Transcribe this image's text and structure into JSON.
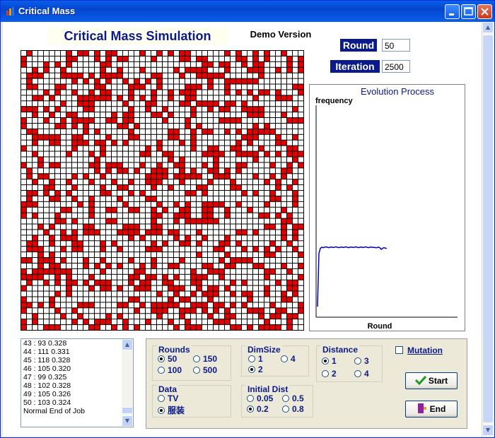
{
  "window": {
    "title": "Critical Mass"
  },
  "header": {
    "app_title": "Critical Mass Simulation",
    "demo_label": "Demo Version"
  },
  "params": {
    "round_label": "Round",
    "round_value": "50",
    "iteration_label": "Iteration",
    "iteration_value": "2500"
  },
  "chart": {
    "title": "Evolution Process",
    "ylabel": "frequency",
    "xlabel": "Round"
  },
  "chart_data": {
    "type": "line",
    "title": "Evolution Process",
    "xlabel": "Round",
    "ylabel": "frequency",
    "x": [
      1,
      2,
      3,
      4,
      5,
      6,
      7,
      8,
      9,
      10,
      11,
      12,
      13,
      14,
      15,
      16,
      17,
      18,
      19,
      20,
      21,
      22,
      23,
      24,
      25,
      26,
      27,
      28,
      29,
      30,
      31,
      32,
      33,
      34,
      35,
      36,
      37,
      38,
      39,
      40,
      41,
      42,
      43,
      44,
      45,
      46,
      47,
      48,
      49,
      50
    ],
    "values": [
      0.05,
      0.3,
      0.325,
      0.33,
      0.328,
      0.33,
      0.332,
      0.33,
      0.328,
      0.33,
      0.331,
      0.329,
      0.33,
      0.332,
      0.33,
      0.328,
      0.33,
      0.331,
      0.329,
      0.33,
      0.332,
      0.33,
      0.328,
      0.33,
      0.331,
      0.329,
      0.33,
      0.332,
      0.33,
      0.328,
      0.33,
      0.331,
      0.329,
      0.33,
      0.332,
      0.33,
      0.328,
      0.33,
      0.331,
      0.329,
      0.33,
      0.328,
      0.328,
      0.331,
      0.328,
      0.32,
      0.325,
      0.328,
      0.326,
      0.324
    ],
    "xlim": [
      0,
      100
    ],
    "ylim": [
      0,
      1
    ],
    "grid": false
  },
  "log": {
    "lines": [
      "43 : 93  0.328",
      "44 : 111  0.331",
      "45 : 118  0.328",
      "46 : 105  0.320",
      "47 : 99  0.325",
      "48 : 102  0.328",
      "49 : 105  0.326",
      "50 : 103  0.324",
      "Normal End of Job"
    ]
  },
  "controls": {
    "rounds": {
      "label": "Rounds",
      "options": [
        "50",
        "150",
        "100",
        "500"
      ],
      "selected": "50"
    },
    "dimsize": {
      "label": "DimSize",
      "options": [
        "1",
        "4",
        "2"
      ],
      "selected": "2"
    },
    "distance": {
      "label": "Distance",
      "options": [
        "1",
        "3",
        "2",
        "4"
      ],
      "selected": "1"
    },
    "data": {
      "label": "Data",
      "options": [
        "TV",
        "服装"
      ],
      "selected": "服装"
    },
    "initial_dist": {
      "label": "Initial Dist",
      "options": [
        "0.05",
        "0.5",
        "0.2",
        "0.8"
      ],
      "selected": "0.2"
    },
    "mutation_label": "Mutation",
    "start_label": "Start",
    "end_label": "End"
  },
  "colors": {
    "cell_on": "#e00000",
    "cell_off": "#ffffff",
    "grid_line": "#000000",
    "curve": "#0000cc",
    "accent": "#0a1a8a"
  },
  "grid_data": {
    "rows": 50,
    "cols": 50,
    "fill_ratio": 0.33,
    "seed": 7
  }
}
